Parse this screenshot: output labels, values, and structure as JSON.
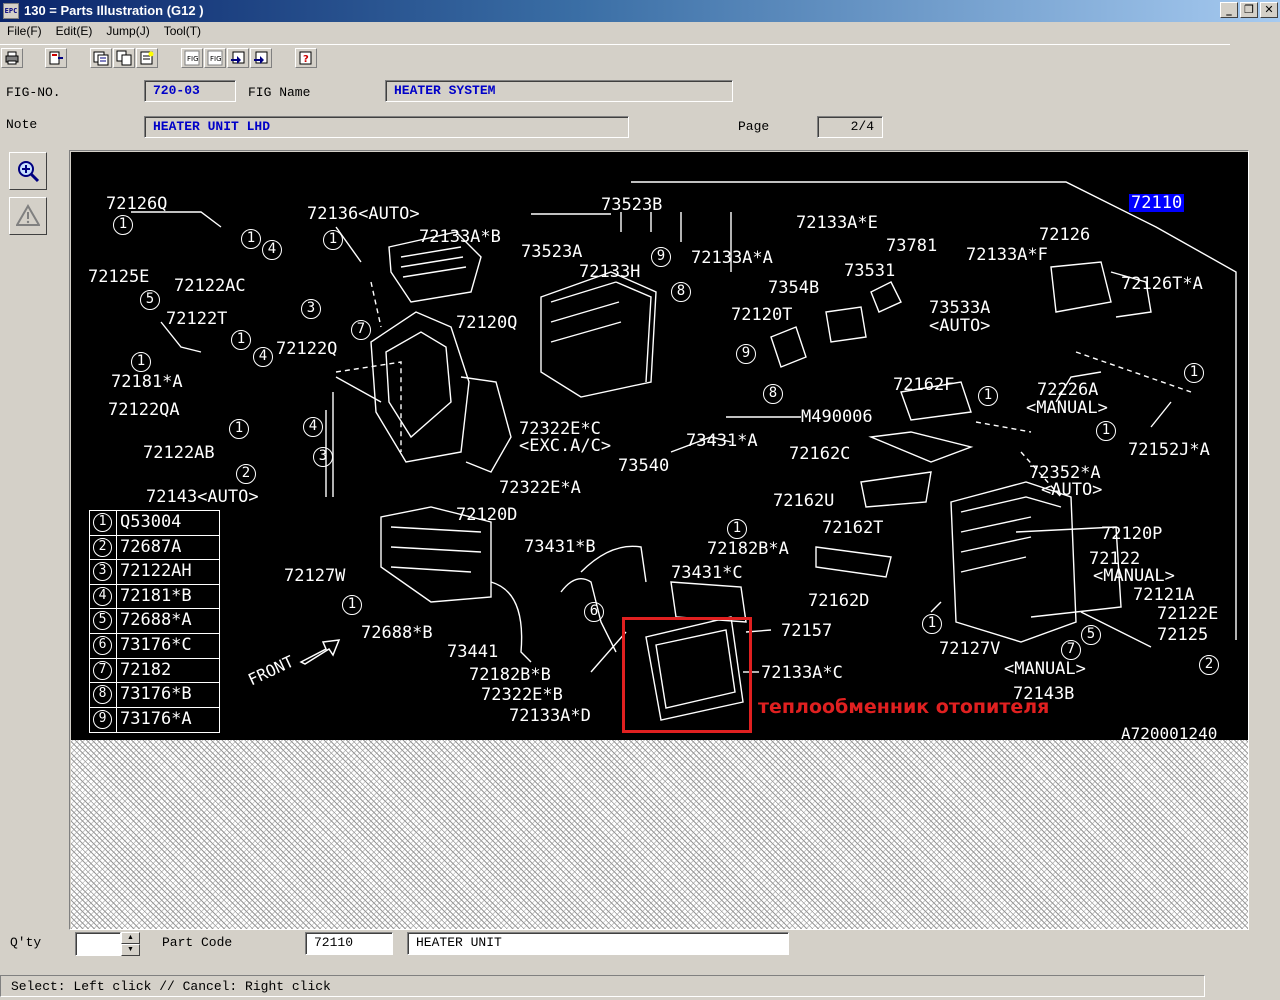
{
  "window": {
    "title": "130 = Parts Illustration (G12  )",
    "icon": "app-icon"
  },
  "window_buttons": [
    "minimize",
    "restore",
    "close"
  ],
  "menu": [
    {
      "label": "File(F)"
    },
    {
      "label": "Edit(E)"
    },
    {
      "label": "Jump(J)"
    },
    {
      "label": "Tool(T)"
    }
  ],
  "toolbar": [
    "print-icon",
    "exit-icon",
    "list-icon",
    "copy-icon",
    "note-icon",
    "fig-prev-icon",
    "fig-next-icon",
    "page-prev-icon",
    "page-next-icon",
    "help-icon"
  ],
  "form": {
    "fig_no_label": "FIG-NO.",
    "fig_no": "720-03",
    "fig_name_label": "FIG Name",
    "fig_name": "HEATER SYSTEM",
    "note_label": "Note",
    "note": "HEATER UNIT LHD",
    "page_label": "Page",
    "page": "2/4"
  },
  "side_tools": [
    "zoom-icon",
    "warning-icon"
  ],
  "diagram": {
    "selected_part": "72110",
    "figure_code": "A720001240",
    "front_label": "FRONT",
    "labels": {
      "l01": "72126Q",
      "l02": "72136<AUTO>",
      "l03": "72133A*B",
      "l04": "73523B",
      "l05": "73523A",
      "l06": "72133H",
      "l07": "72133A*A",
      "l08": "72133A*E",
      "l09": "73781",
      "l10": "72126",
      "l11": "72133A*F",
      "l12": "72125E",
      "l13": "72122AC",
      "l14": "72120Q",
      "l15": "73531",
      "l16": "7354B",
      "l17": "72120T",
      "l18": "73533A",
      "l19": "<AUTO>",
      "l20": "72126T*A",
      "l21": "72122T",
      "l22": "72122Q",
      "l23": "72181*A",
      "l24": "72122QA",
      "l25": "72162F",
      "l26": "72226A",
      "l27": "<MANUAL>",
      "l28": "M490006",
      "l29": "72322E*C",
      "l30": "<EXC.A/C>",
      "l31": "73431*A",
      "l32": "72122AB",
      "l33": "72152J*A",
      "l34": "72162C",
      "l35": "73540",
      "l36": "72322E*A",
      "l37": "72352*A",
      "l38": "<AUTO>",
      "l39": "72143<AUTO>",
      "l40": "72162U",
      "l41": "72120D",
      "l42": "72162T",
      "l43": "72120P",
      "l44": "73431*B",
      "l45": "72182B*A",
      "l46": "72122",
      "l47": "<MANUAL>",
      "l48": "73431*C",
      "l49": "72127W",
      "l50": "72121A",
      "l51": "72162D",
      "l52": "72122E",
      "l53": "72157",
      "l54": "72125",
      "l55": "72688*B",
      "l56": "73441",
      "l57": "72127V",
      "l58": "72133A*C",
      "l59": "<MANUAL>",
      "l60": "72182B*B",
      "l61": "72143B",
      "l62": "72322E*B",
      "l63": "72133A*D"
    },
    "legend": [
      {
        "n": "1",
        "code": "Q53004"
      },
      {
        "n": "2",
        "code": "72687A"
      },
      {
        "n": "3",
        "code": "72122AH"
      },
      {
        "n": "4",
        "code": "72181*B"
      },
      {
        "n": "5",
        "code": "72688*A"
      },
      {
        "n": "6",
        "code": "73176*C"
      },
      {
        "n": "7",
        "code": "72182"
      },
      {
        "n": "8",
        "code": "73176*B"
      },
      {
        "n": "9",
        "code": "73176*A"
      }
    ],
    "annotation": "теплообменник отопителя",
    "highlight_color": "#e02020"
  },
  "bottom": {
    "qty_label": "Q'ty",
    "qty_value": "",
    "part_code_label": "Part Code",
    "part_code": "72110",
    "part_name": "HEATER UNIT"
  },
  "status": "Select: Left click // Cancel: Right click"
}
